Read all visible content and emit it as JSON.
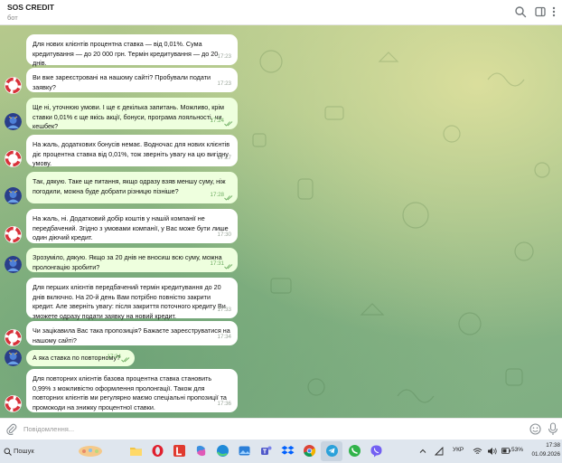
{
  "header": {
    "title": "SOS CREDIT",
    "subtitle": "бот"
  },
  "messages": [
    {
      "dir": "in",
      "text": "Для нових клієнтів процентна ставка — від 0,01%. Сума кредитування — до 20 000 грн. Термін кредитування — до 20 днів.",
      "time": "17:23"
    },
    {
      "dir": "in",
      "text": "Ви вже зареєстровані на нашому сайті? Пробували подати заявку?",
      "time": "17:23"
    },
    {
      "dir": "out",
      "text": "Ще ні, уточнюю умови. І ще є декілька запитань. Можливо, крім ставки 0,01% є ще якісь акції, бонуси, програма лояльності, чи кешбек?",
      "time": "17:24"
    },
    {
      "dir": "in",
      "text": "На жаль, додаткових бонусів немає. Водночас для нових клієнтів діє процентна ставка від 0,01%, тож зверніть увагу на цю вигідну умову.",
      "time": "17:27"
    },
    {
      "dir": "out",
      "text": "Так, дякую. Таке ще питання, якщо одразу взяв меншу суму, ніж погодили, можна буде добрати різницю пізніше?",
      "time": "17:28"
    },
    {
      "dir": "in",
      "text": "На жаль, ні. Додатковий добір коштів у нашій компанії не передбачений. Згідно з умовами компанії, у Вас може бути лише один діючий кредит.",
      "time": "17:30"
    },
    {
      "dir": "out",
      "text": "Зрозуміло, дякую. Якщо за 20 днів не вносиш всю суму, можна пролонгацію зробити?",
      "time": "17:31"
    },
    {
      "dir": "in",
      "text": "Для перших клієнтів передбачений термін кредитування до 20 днів включно. На 20-й день Вам потрібно повністю закрити кредит. Але зверніть увагу: після закриття поточного кредиту Ви зможете одразу подати заявку на новий кредит.",
      "time": "17:33"
    },
    {
      "dir": "in",
      "text": "Чи зацікавила Вас така пропозиція? Бажаєте зареєструватися на нашому сайті?",
      "time": "17:34"
    },
    {
      "dir": "out",
      "text": "А яка ставка по повторному?",
      "time": "17:34"
    },
    {
      "dir": "in",
      "text": "Для повторних клієнтів базова процентна ставка становить 0,99% з можливістю оформлення пролонгації. Також для повторних клієнтів ми регулярно маємо спеціальні пропозиції та промокоди на знижку процентної ставки.",
      "time": "17:36"
    }
  ],
  "input": {
    "placeholder": "Повідомлення..."
  },
  "taskbar": {
    "search_label": "Пошук",
    "lang": "УКР",
    "battery": "53%",
    "time": "17:38",
    "date": "01.09.2026"
  },
  "icons": {
    "header": [
      "search-icon",
      "sidebar-toggle-icon",
      "more-vertical-icon"
    ],
    "input": [
      "attach-icon",
      "emoji-icon",
      "microphone-icon"
    ],
    "taskbar": [
      "windows-start-icon",
      "search-icon",
      "file-explorer-icon",
      "opera-icon",
      "l-app-icon",
      "copilot-icon",
      "edge-icon",
      "photos-icon",
      "teams-icon",
      "dropbox-icon",
      "chrome-icon",
      "telegram-icon",
      "viber-green-icon",
      "viber-icon"
    ]
  },
  "colors": {
    "accent": "#4fa3e0",
    "outgoing_bubble": "#eeffde",
    "incoming_bubble": "#ffffff",
    "tick": "#6fae63"
  }
}
